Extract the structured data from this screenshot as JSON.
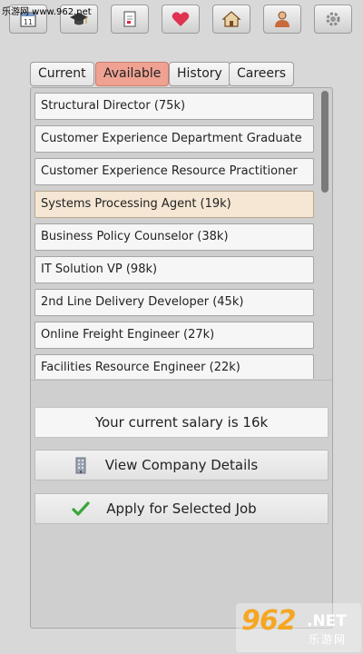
{
  "watermark": {
    "top_text": "乐游网 www.962.net",
    "bottom_logo": "962",
    "bottom_net": ".NET",
    "bottom_sub": "乐游网"
  },
  "toolbar": {
    "buttons": [
      {
        "icon": "calendar-icon"
      },
      {
        "icon": "graduation-cap-icon"
      },
      {
        "icon": "document-icon"
      },
      {
        "icon": "heart-icon"
      },
      {
        "icon": "house-icon"
      },
      {
        "icon": "person-icon"
      },
      {
        "icon": "gear-icon"
      }
    ]
  },
  "tabs": [
    {
      "label": "Current",
      "active": false
    },
    {
      "label": "Available",
      "active": true
    },
    {
      "label": "History",
      "active": false
    },
    {
      "label": "Careers",
      "active": false
    }
  ],
  "jobs": [
    {
      "label": "Structural Director (75k)",
      "selected": false
    },
    {
      "label": "Customer Experience Department Graduate",
      "selected": false
    },
    {
      "label": "Customer Experience Resource Practitioner",
      "selected": false
    },
    {
      "label": "Systems Processing Agent (19k)",
      "selected": true
    },
    {
      "label": "Business Policy Counselor (38k)",
      "selected": false
    },
    {
      "label": "IT Solution VP (98k)",
      "selected": false
    },
    {
      "label": "2nd Line Delivery Developer (45k)",
      "selected": false
    },
    {
      "label": "Online Freight Engineer (27k)",
      "selected": false
    },
    {
      "label": "Facilities Resource Engineer (22k)",
      "selected": false
    }
  ],
  "salary_text": "Your current salary is 16k",
  "actions": {
    "view_company": {
      "label": "View Company Details",
      "icon": "building-icon"
    },
    "apply": {
      "label": "Apply for Selected Job",
      "icon": "checkmark-icon"
    }
  },
  "colors": {
    "active_tab": "#f0a292",
    "selected_job": "#f5e7d4",
    "heart": "#e0334f",
    "check": "#3aa53a"
  }
}
